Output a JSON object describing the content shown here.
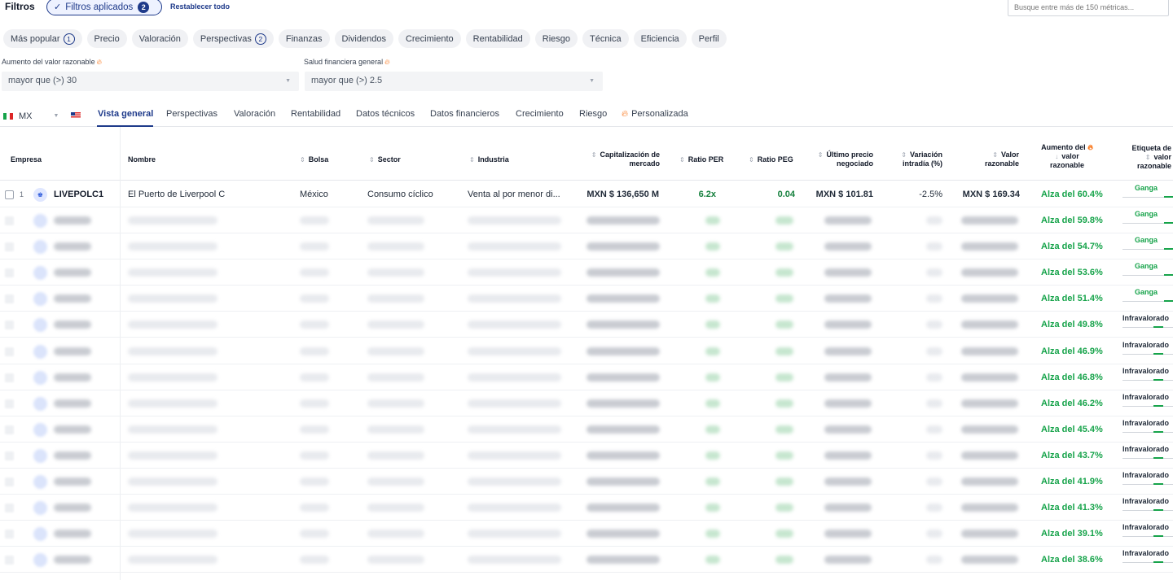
{
  "header": {
    "filters_title": "Filtros",
    "applied_label": "Filtros aplicados",
    "applied_count": "2",
    "reset_label": "Restablecer todo",
    "search_placeholder": "Busque entre más de 150 métricas..."
  },
  "chips": [
    {
      "label": "Más popular",
      "badge": "1"
    },
    {
      "label": "Precio",
      "badge": ""
    },
    {
      "label": "Valoración",
      "badge": ""
    },
    {
      "label": "Perspectivas",
      "badge": "2"
    },
    {
      "label": "Finanzas",
      "badge": ""
    },
    {
      "label": "Dividendos",
      "badge": ""
    },
    {
      "label": "Crecimiento",
      "badge": ""
    },
    {
      "label": "Rentabilidad",
      "badge": ""
    },
    {
      "label": "Riesgo",
      "badge": ""
    },
    {
      "label": "Técnica",
      "badge": ""
    },
    {
      "label": "Eficiencia",
      "badge": ""
    },
    {
      "label": "Perfil",
      "badge": ""
    }
  ],
  "filters": [
    {
      "label": "Aumento del valor razonable",
      "value": "mayor que (>) 30"
    },
    {
      "label": "Salud financiera general",
      "value": "mayor que (>) 2.5"
    }
  ],
  "market": {
    "country": "MX"
  },
  "tabs": [
    {
      "label": "Vista general",
      "active": true
    },
    {
      "label": "Perspectivas",
      "active": false
    },
    {
      "label": "Valoración",
      "active": false
    },
    {
      "label": "Rentabilidad",
      "active": false
    },
    {
      "label": "Datos técnicos",
      "active": false
    },
    {
      "label": "Datos financieros",
      "active": false
    },
    {
      "label": "Crecimiento",
      "active": false
    },
    {
      "label": "Riesgo",
      "active": false
    },
    {
      "label": "Personalizada",
      "active": false
    }
  ],
  "columns": {
    "empresa": "Empresa",
    "nombre": "Nombre",
    "bolsa": "Bolsa",
    "sector": "Sector",
    "industria": "Industria",
    "cap_1": "Capitalización de",
    "cap_2": "mercado",
    "per": "Ratio PER",
    "peg": "Ratio PEG",
    "precio_1": "Último precio",
    "precio_2": "negociado",
    "var_1": "Variación",
    "var_2": "intradía (%)",
    "valor_1": "Valor",
    "valor_2": "razonable",
    "aumento_1": "Aumento del",
    "aumento_2": "valor",
    "aumento_3": "razonable",
    "etiqueta_1": "Etiqueta de",
    "etiqueta_2": "valor",
    "etiqueta_3": "razonable"
  },
  "first_row": {
    "rank": "1",
    "ticker": "LIVEPOLC1",
    "name": "El Puerto de Liverpool C",
    "exchange": "México",
    "sector": "Consumo cíclico",
    "industry": "Venta al por menor di...",
    "market_cap": "MXN $ 136,650 M",
    "per": "6.2x",
    "peg": "0.04",
    "last_price": "MXN $ 101.81",
    "change": "-2.5%",
    "fair_value": "MXN $ 169.34",
    "upside": "Alza del 60.4%",
    "label": "Ganga",
    "meter": 0.18
  },
  "rows": [
    {
      "upside": "Alza del 59.8%",
      "label": "Ganga",
      "meter": 0.18
    },
    {
      "upside": "Alza del 54.7%",
      "label": "Ganga",
      "meter": 0.18
    },
    {
      "upside": "Alza del 53.6%",
      "label": "Ganga",
      "meter": 0.18
    },
    {
      "upside": "Alza del 51.4%",
      "label": "Ganga",
      "meter": 0.18
    },
    {
      "upside": "Alza del 49.8%",
      "label": "Infravalorado",
      "meter": 0.2
    },
    {
      "upside": "Alza del 46.9%",
      "label": "Infravalorado",
      "meter": 0.2
    },
    {
      "upside": "Alza del 46.8%",
      "label": "Infravalorado",
      "meter": 0.2
    },
    {
      "upside": "Alza del 46.2%",
      "label": "Infravalorado",
      "meter": 0.2
    },
    {
      "upside": "Alza del 45.4%",
      "label": "Infravalorado",
      "meter": 0.2
    },
    {
      "upside": "Alza del 43.7%",
      "label": "Infravalorado",
      "meter": 0.2
    },
    {
      "upside": "Alza del 41.9%",
      "label": "Infravalorado",
      "meter": 0.2
    },
    {
      "upside": "Alza del 41.3%",
      "label": "Infravalorado",
      "meter": 0.2
    },
    {
      "upside": "Alza del 39.1%",
      "label": "Infravalorado",
      "meter": 0.2
    },
    {
      "upside": "Alza del 38.6%",
      "label": "Infravalorado",
      "meter": 0.2
    }
  ],
  "colors": {
    "brand": "#1e3a8a",
    "positive": "#16a34a",
    "accent_fire": "#f97316"
  }
}
